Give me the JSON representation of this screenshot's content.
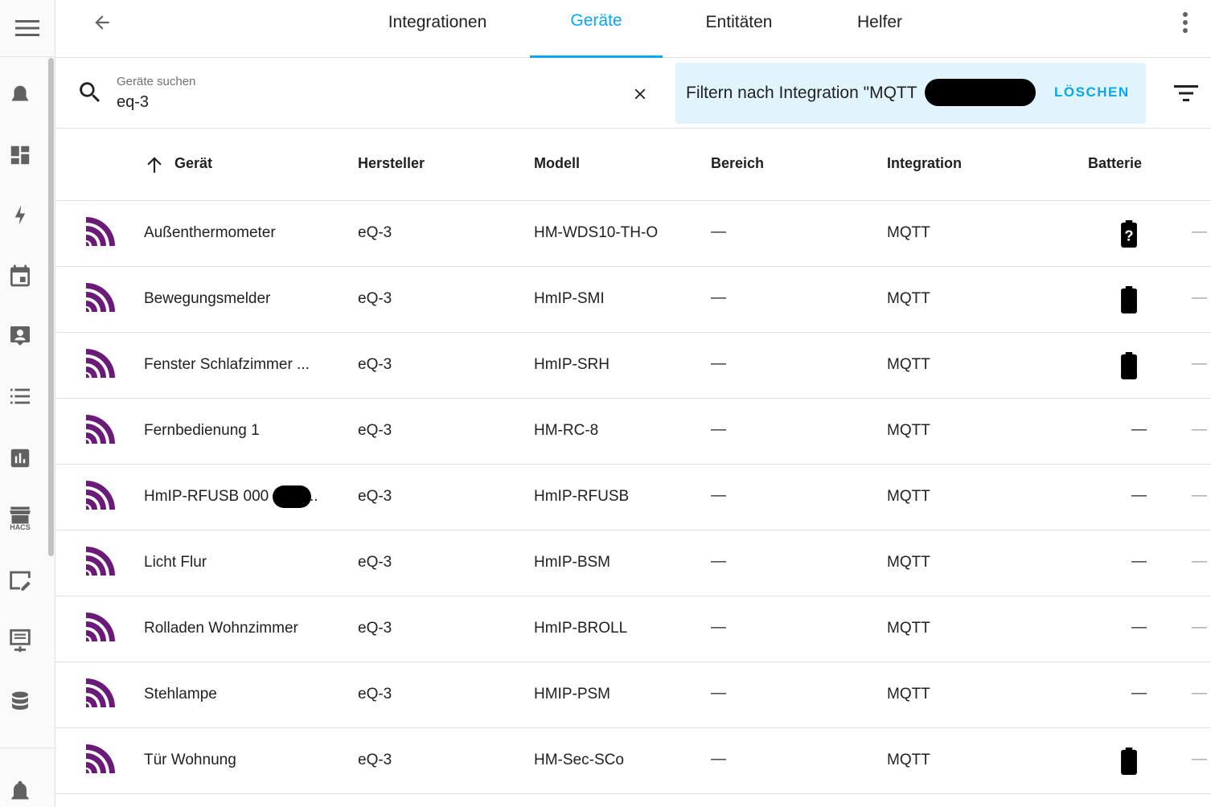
{
  "colors": {
    "accent": "#03a9f4",
    "brand_logo": "#6b1a7a",
    "chip_bg": "#e1f3fc"
  },
  "sidebar": {
    "items": [
      {
        "icon": "menu-icon"
      },
      {
        "icon": "bell-outline-icon"
      },
      {
        "icon": "dashboard-icon"
      },
      {
        "icon": "lightning-icon"
      },
      {
        "icon": "calendar-icon"
      },
      {
        "icon": "account-box-icon"
      },
      {
        "icon": "list-icon"
      },
      {
        "icon": "chart-box-icon"
      },
      {
        "icon": "hacs-store-icon",
        "label": "HACS"
      },
      {
        "icon": "edit-window-icon"
      },
      {
        "icon": "monitor-network-icon"
      },
      {
        "icon": "database-icon"
      },
      {
        "icon": "notification-bell-icon"
      }
    ]
  },
  "header": {
    "tabs": [
      {
        "label": "Integrationen",
        "active": false
      },
      {
        "label": "Geräte",
        "active": true
      },
      {
        "label": "Entitäten",
        "active": false
      },
      {
        "label": "Helfer",
        "active": false
      }
    ]
  },
  "search": {
    "label": "Geräte suchen",
    "value": "eq-3"
  },
  "filter": {
    "text": "Filtern nach Integration \"MQTT",
    "clear_label": "LÖSCHEN"
  },
  "table": {
    "columns": [
      "Gerät",
      "Hersteller",
      "Modell",
      "Bereich",
      "Integration",
      "Batterie"
    ],
    "rows": [
      {
        "name": "Außenthermometer",
        "manufacturer": "eQ-3",
        "model": "HM-WDS10-TH-O",
        "area": "—",
        "integration": "MQTT",
        "battery": "unknown",
        "extra": "—"
      },
      {
        "name": "Bewegungsmelder",
        "manufacturer": "eQ-3",
        "model": "HmIP-SMI",
        "area": "—",
        "integration": "MQTT",
        "battery": "full",
        "extra": "—"
      },
      {
        "name": "Fenster Schlafzimmer ...",
        "manufacturer": "eQ-3",
        "model": "HmIP-SRH",
        "area": "—",
        "integration": "MQTT",
        "battery": "full",
        "extra": "—"
      },
      {
        "name": "Fernbedienung 1",
        "manufacturer": "eQ-3",
        "model": "HM-RC-8",
        "area": "—",
        "integration": "MQTT",
        "battery": "—",
        "extra": "—"
      },
      {
        "name": "HmIP-RFUSB 000",
        "name_suffix": "..",
        "manufacturer": "eQ-3",
        "model": "HmIP-RFUSB",
        "area": "—",
        "integration": "MQTT",
        "battery": "—",
        "extra": "—"
      },
      {
        "name": "Licht Flur",
        "manufacturer": "eQ-3",
        "model": "HmIP-BSM",
        "area": "—",
        "integration": "MQTT",
        "battery": "—",
        "extra": "—"
      },
      {
        "name": "Rolladen Wohnzimmer",
        "manufacturer": "eQ-3",
        "model": "HmIP-BROLL",
        "area": "—",
        "integration": "MQTT",
        "battery": "—",
        "extra": "—"
      },
      {
        "name": "Stehlampe",
        "manufacturer": "eQ-3",
        "model": "HMIP-PSM",
        "area": "—",
        "integration": "MQTT",
        "battery": "—",
        "extra": "—"
      },
      {
        "name": "Tür Wohnung",
        "manufacturer": "eQ-3",
        "model": "HM-Sec-SCo",
        "area": "—",
        "integration": "MQTT",
        "battery": "full",
        "extra": "—"
      }
    ]
  }
}
